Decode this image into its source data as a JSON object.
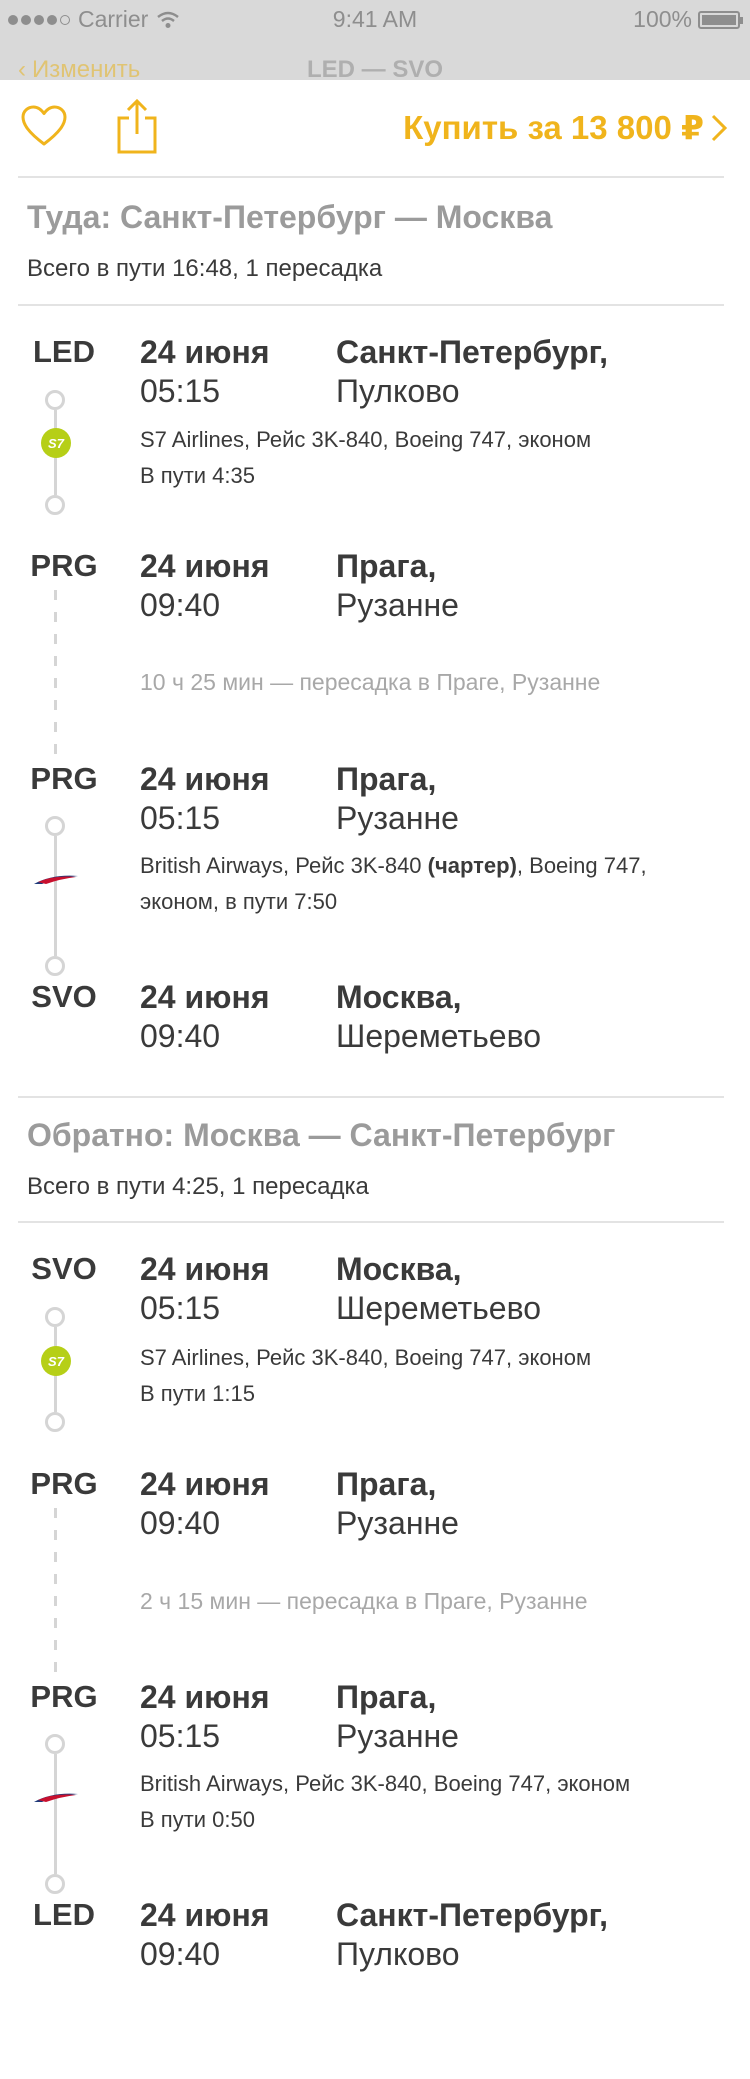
{
  "status_bar": {
    "carrier": "Carrier",
    "time": "9:41 AM",
    "battery": "100%"
  },
  "behind_nav": {
    "back_label": "Изменить",
    "title": "LED — SVO"
  },
  "toolbar": {
    "buy_label": "Купить за 13 800 ₽"
  },
  "outbound": {
    "title": "Туда: Санкт-Петербург — Москва",
    "summary": "Всего в пути 16:48, 1 пересадка",
    "stops": [
      {
        "code": "LED",
        "date": "24 июня",
        "time": "05:15",
        "city": "Санкт-Петербург,",
        "airport": "Пулково"
      },
      {
        "code": "PRG",
        "date": "24 июня",
        "time": "09:40",
        "city": "Прага,",
        "airport": "Рузанне"
      },
      {
        "code": "PRG",
        "date": "24 июня",
        "time": "05:15",
        "city": "Прага,",
        "airport": "Рузанне"
      },
      {
        "code": "SVO",
        "date": "24 июня",
        "time": "09:40",
        "city": "Москва,",
        "airport": "Шереметьево"
      }
    ],
    "segments": [
      {
        "airline_icon": "s7-logo-icon",
        "line1": "S7 Airlines, Рейс 3K-840, Boeing 747, эконом",
        "line2": "В пути 4:35"
      },
      {
        "airline_icon": "british-airways-logo-icon",
        "line1_a": "British Airways, Рейс 3K-840 ",
        "line1_bold": "(чартер)",
        "line1_b": ", Boeing 747,",
        "line2": "эконом, в пути 7:50"
      }
    ],
    "layover": "10 ч 25 мин — пересадка в Праге, Рузанне"
  },
  "return": {
    "title": "Обратно: Москва — Санкт-Петербург",
    "summary": "Всего в пути 4:25, 1 пересадка",
    "stops": [
      {
        "code": "SVO",
        "date": "24 июня",
        "time": "05:15",
        "city": "Москва,",
        "airport": "Шереметьево"
      },
      {
        "code": "PRG",
        "date": "24 июня",
        "time": "09:40",
        "city": "Прага,",
        "airport": "Рузанне"
      },
      {
        "code": "PRG",
        "date": "24 июня",
        "time": "05:15",
        "city": "Прага,",
        "airport": "Рузанне"
      },
      {
        "code": "LED",
        "date": "24 июня",
        "time": "09:40",
        "city": "Санкт-Петербург,",
        "airport": "Пулково"
      }
    ],
    "segments": [
      {
        "airline_icon": "s7-logo-icon",
        "line1": "S7 Airlines, Рейс 3K-840, Boeing 747, эконом",
        "line2": "В пути 1:15"
      },
      {
        "airline_icon": "british-airways-logo-icon",
        "line1": "British Airways, Рейс 3K-840, Boeing 747, эконом",
        "line2": "В пути 0:50"
      }
    ],
    "layover": "2 ч 15 мин — пересадка в Праге, Рузанне"
  },
  "colors": {
    "accent": "#f0b41c",
    "s7_green": "#b6cf17",
    "ba_red": "#c8102e",
    "ba_blue": "#1d3a7a",
    "muted": "#9b9b9b"
  }
}
